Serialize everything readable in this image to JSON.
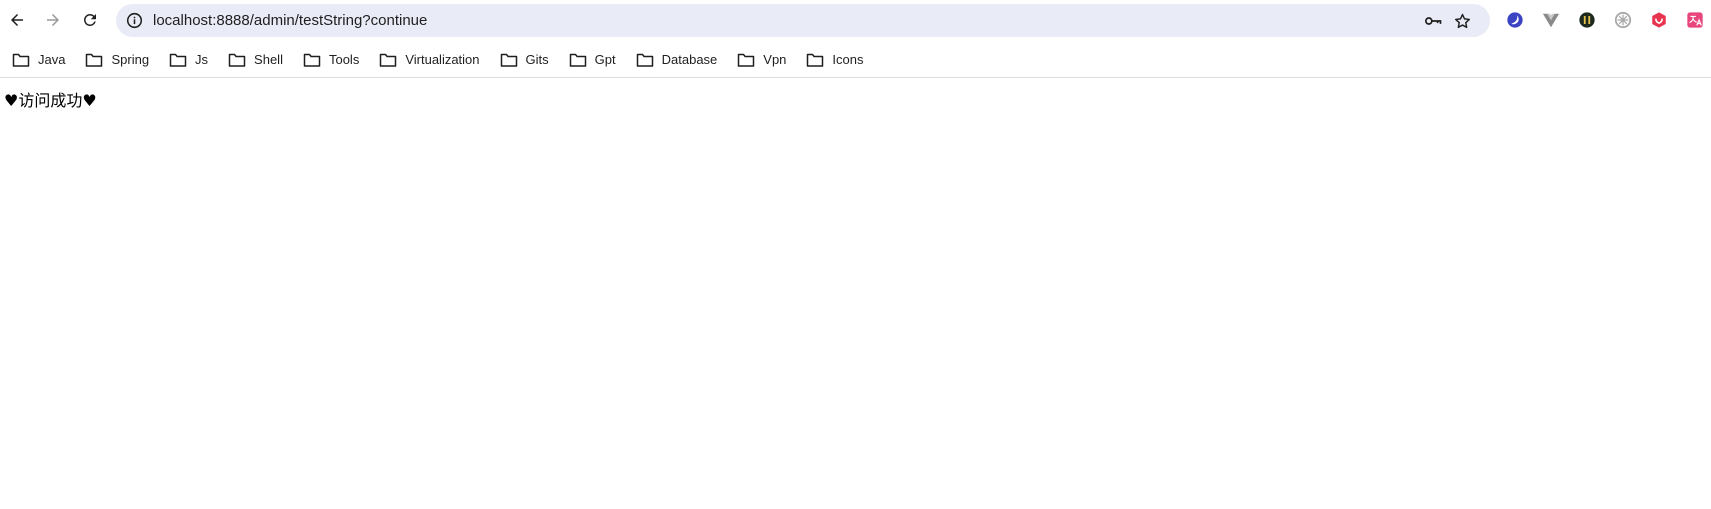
{
  "browser": {
    "address_bar": {
      "url": "localhost:8888/admin/testString?continue"
    },
    "extensions": [
      {
        "icon": "blue-swirl-extension-icon",
        "color": "#3b45c4"
      },
      {
        "icon": "vue-devtools-extension-icon",
        "color": "#8a8a8a"
      },
      {
        "icon": "dark-circle-extension-icon",
        "color": "#1f2a1f"
      },
      {
        "icon": "grey-gear-extension-icon",
        "color": "#a8a8a8"
      },
      {
        "icon": "red-shield-extension-icon",
        "color": "#e8344e"
      },
      {
        "icon": "translate-extension-icon",
        "color": "#e8467c"
      }
    ]
  },
  "bookmarks": [
    {
      "label": "Java"
    },
    {
      "label": "Spring"
    },
    {
      "label": "Js"
    },
    {
      "label": "Shell"
    },
    {
      "label": "Tools"
    },
    {
      "label": "Virtualization"
    },
    {
      "label": "Gits"
    },
    {
      "label": "Gpt"
    },
    {
      "label": "Database"
    },
    {
      "label": "Vpn"
    },
    {
      "label": "Icons"
    }
  ],
  "page": {
    "message": "♥访问成功♥"
  }
}
